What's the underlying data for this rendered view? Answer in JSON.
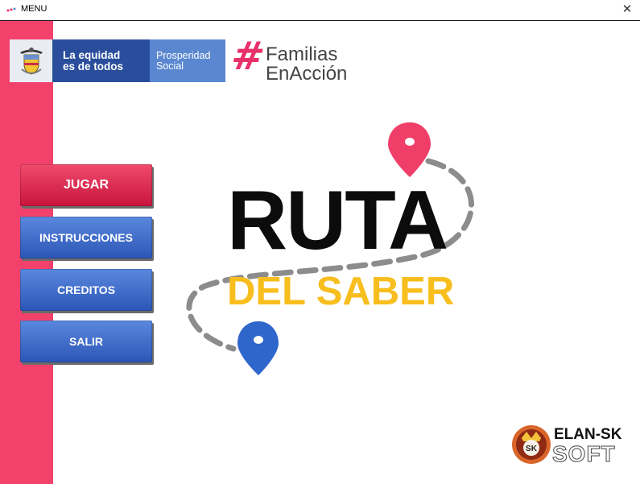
{
  "window": {
    "title": "MENU",
    "close_glyph": "✕"
  },
  "header": {
    "equity_line1": "La equidad",
    "equity_line2": "es de todos",
    "prosperity_line1": "Prosperidad",
    "prosperity_line2": "Social",
    "program_line1": "Familias",
    "program_line2": "EnAcción"
  },
  "menu": {
    "play_label": "JUGAR",
    "instructions_label": "INSTRUCCIONES",
    "credits_label": "CREDITOS",
    "exit_label": "SALIR"
  },
  "game_title": {
    "line1": "RUTA",
    "line2": "DEL SABER"
  },
  "studio": {
    "name_line1": "ELAN-SK",
    "name_line2": "SOFT",
    "emblem_text": "SK"
  },
  "icons": {
    "app": "app-icon",
    "close": "close-icon",
    "shield": "coat-of-arms-icon",
    "hash": "hash-icon",
    "pin_top": "map-pin-icon",
    "pin_bottom": "map-pin-icon"
  },
  "colors": {
    "sidebar": "#f2416b",
    "play_button": "#d81e47",
    "menu_button": "#3a66c6",
    "title_black": "#0c0c0c",
    "title_yellow": "#f7be1e",
    "pin_pink": "#ef3f68",
    "pin_blue": "#2f66cc",
    "equity_blue": "#2a4e9c",
    "prosperity_blue": "#5a87d0"
  }
}
